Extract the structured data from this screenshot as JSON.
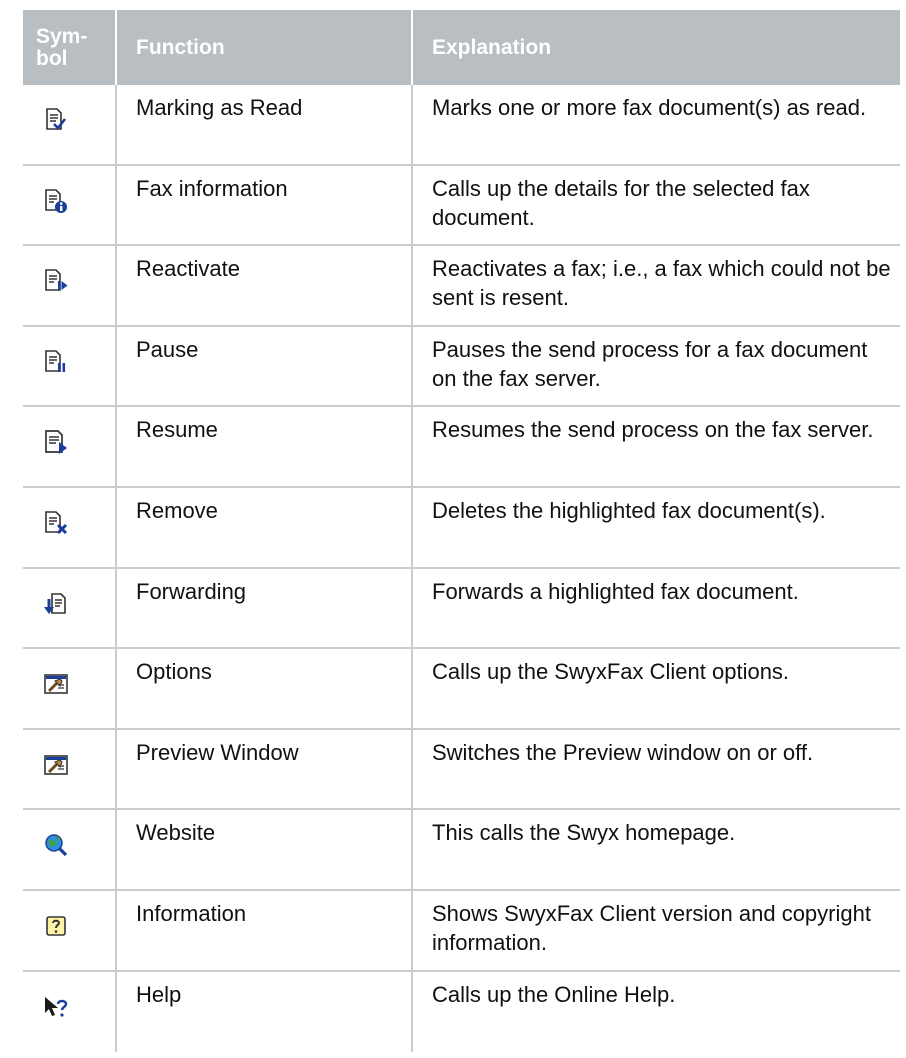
{
  "header": {
    "symbol": "Sym-\nbol",
    "function": "Function",
    "explanation": "Explanation"
  },
  "rows": [
    {
      "icon": "mark-read-icon",
      "function": "Marking as Read",
      "explanation": "Marks one or more fax document(s) as read."
    },
    {
      "icon": "fax-info-icon",
      "function": "Fax information",
      "explanation": "Calls up the details for the selected fax document."
    },
    {
      "icon": "reactivate-icon",
      "function": "Reactivate",
      "explanation": "Reactivates a fax; i.e., a fax which could not be sent is resent."
    },
    {
      "icon": "pause-icon",
      "function": "Pause",
      "explanation": "Pauses the send process for a fax document on the fax server."
    },
    {
      "icon": "resume-icon",
      "function": "Resume",
      "explanation": "Resumes the send process on the fax server."
    },
    {
      "icon": "remove-icon",
      "function": "Remove",
      "explanation": "Deletes the highlighted fax document(s)."
    },
    {
      "icon": "forwarding-icon",
      "function": "Forwarding",
      "explanation": "Forwards a highlighted fax document."
    },
    {
      "icon": "options-icon",
      "function": "Options",
      "explanation": "Calls up the SwyxFax Client options."
    },
    {
      "icon": "preview-window-icon",
      "function": "Preview Window",
      "explanation": "Switches the Preview window on or off."
    },
    {
      "icon": "website-icon",
      "function": "Website",
      "explanation": "This calls the Swyx homepage."
    },
    {
      "icon": "information-icon",
      "function": "Information",
      "explanation": "Shows SwyxFax Client version and copyright information."
    },
    {
      "icon": "help-icon",
      "function": "Help",
      "explanation": "Calls up the Online Help."
    }
  ]
}
